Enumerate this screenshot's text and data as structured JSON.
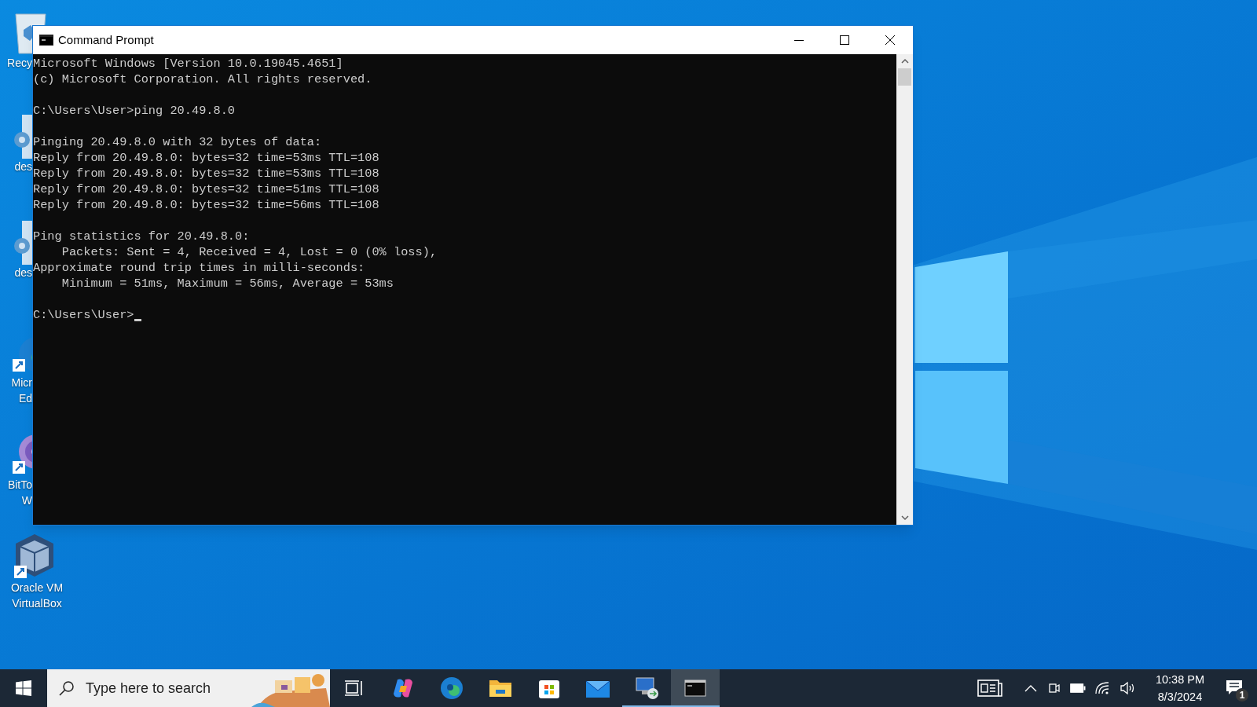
{
  "desktop_icons": [
    {
      "kind": "recycle",
      "label_lines": [
        "Recy"
      ]
    },
    {
      "kind": "gear",
      "label_lines": [
        "des"
      ]
    },
    {
      "kind": "gear",
      "label_lines": [
        "des"
      ]
    },
    {
      "kind": "edge",
      "label_lines": [
        "Micr",
        "Ed"
      ]
    },
    {
      "kind": "torrent",
      "label_lines": [
        "BitTo",
        "W"
      ]
    },
    {
      "kind": "vbox",
      "label_lines": [
        "Oracle VM",
        "VirtualBox"
      ]
    }
  ],
  "window": {
    "title": "Command Prompt",
    "blocks": [
      [
        "Microsoft Windows [Version 10.0.19045.4651]",
        "(c) Microsoft Corporation. All rights reserved."
      ],
      [
        "C:\\Users\\User>ping 20.49.8.0"
      ],
      [
        "Pinging 20.49.8.0 with 32 bytes of data:",
        "Reply from 20.49.8.0: bytes=32 time=53ms TTL=108",
        "Reply from 20.49.8.0: bytes=32 time=53ms TTL=108",
        "Reply from 20.49.8.0: bytes=32 time=51ms TTL=108",
        "Reply from 20.49.8.0: bytes=32 time=56ms TTL=108"
      ],
      [
        "Ping statistics for 20.49.8.0:",
        "    Packets: Sent = 4, Received = 4, Lost = 0 (0% loss),",
        "Approximate round trip times in milli-seconds:",
        "    Minimum = 51ms, Maximum = 56ms, Average = 53ms"
      ],
      [
        "C:\\Users\\User>"
      ]
    ]
  },
  "taskbar": {
    "search": {
      "placeholder": "Type here to search"
    },
    "apps": [
      {
        "kind": "taskview",
        "running": false,
        "selected": false
      },
      {
        "kind": "copilot",
        "running": false,
        "selected": false
      },
      {
        "kind": "edge",
        "running": false,
        "selected": false
      },
      {
        "kind": "explorer",
        "running": false,
        "selected": false
      },
      {
        "kind": "store",
        "running": false,
        "selected": false
      },
      {
        "kind": "mail",
        "running": false,
        "selected": false
      },
      {
        "kind": "rdp",
        "running": true,
        "selected": false
      },
      {
        "kind": "cmd",
        "running": true,
        "selected": true
      }
    ],
    "clock": {
      "time": "10:38 PM",
      "date": "8/3/2024"
    },
    "notifications": {
      "count": "1"
    }
  }
}
